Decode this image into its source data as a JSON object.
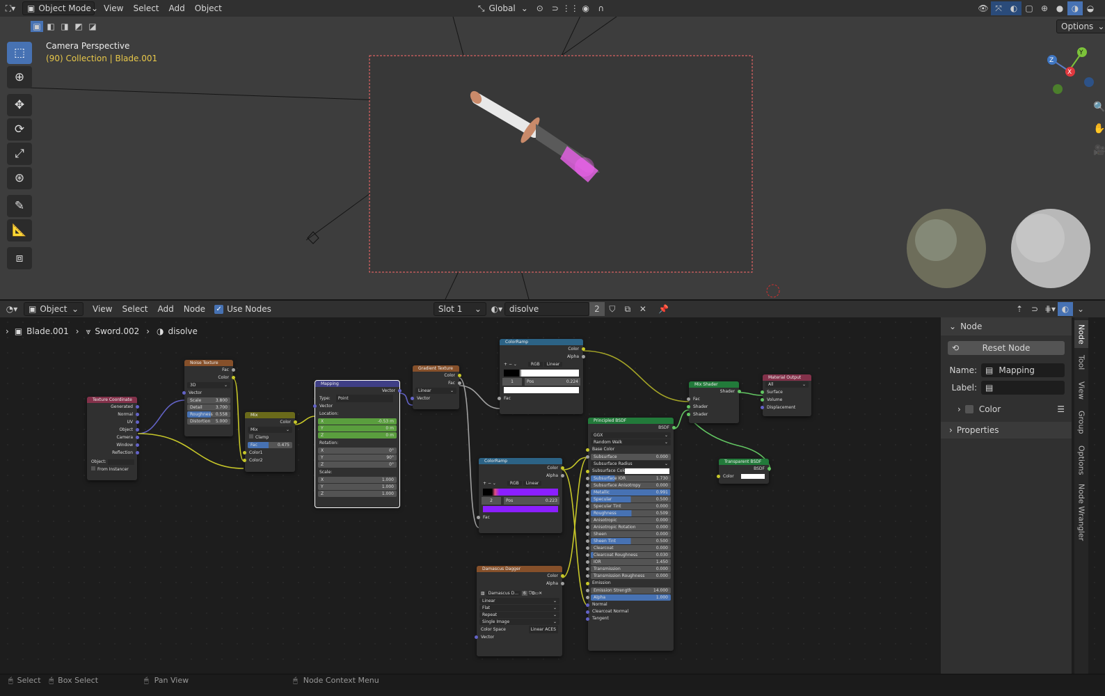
{
  "viewport": {
    "mode": "Object Mode",
    "menus": [
      "View",
      "Select",
      "Add",
      "Object"
    ],
    "transform_orientation": "Global",
    "options_label": "Options",
    "overlay_title": "Camera Perspective",
    "overlay_subtitle": "(90) Collection | Blade.001",
    "axis_labels": {
      "x": "X",
      "y": "Y",
      "z": "Z"
    }
  },
  "node_editor": {
    "object_dropdown": "Object",
    "menus": [
      "View",
      "Select",
      "Add",
      "Node"
    ],
    "use_nodes_label": "Use Nodes",
    "slot": "Slot 1",
    "material_name": "disolve",
    "user_count": "2",
    "breadcrumb": [
      "Blade.001",
      "Sword.002",
      "disolve"
    ]
  },
  "nodes": {
    "texcoord": {
      "title": "Texture Coordinate",
      "outputs": [
        "Generated",
        "Normal",
        "UV",
        "Object",
        "Camera",
        "Window",
        "Reflection"
      ],
      "object_label": "Object:",
      "from_instancer": "From Instancer"
    },
    "noise": {
      "title": "Noise Texture",
      "outputs": [
        "Fac",
        "Color"
      ],
      "dim": "3D",
      "vector": "Vector",
      "fields": [
        {
          "k": "Scale",
          "v": "3.800"
        },
        {
          "k": "Detail",
          "v": "3.700"
        },
        {
          "k": "Roughness",
          "v": "0.558"
        },
        {
          "k": "Distortion",
          "v": "5.000"
        }
      ]
    },
    "mix": {
      "title": "Mix",
      "output": "Color",
      "blend": "Mix",
      "clamp": "Clamp",
      "fac_k": "Fac",
      "fac_v": "0.475",
      "inputs": [
        "Color1",
        "Color2"
      ]
    },
    "mapping": {
      "title": "Mapping",
      "output": "Vector",
      "type_k": "Type:",
      "type_v": "Point",
      "vector": "Vector",
      "location": "Location:",
      "loc": [
        {
          "k": "X",
          "v": "-0.53 m"
        },
        {
          "k": "Y",
          "v": "0 m"
        },
        {
          "k": "Z",
          "v": "0 m"
        }
      ],
      "rotation": "Rotation:",
      "rot": [
        {
          "k": "X",
          "v": "0°"
        },
        {
          "k": "Y",
          "v": "90°"
        },
        {
          "k": "Z",
          "v": "0°"
        }
      ],
      "scale": "Scale:",
      "scl": [
        {
          "k": "X",
          "v": "1.000"
        },
        {
          "k": "Y",
          "v": "1.000"
        },
        {
          "k": "Z",
          "v": "1.000"
        }
      ]
    },
    "gradient": {
      "title": "Gradient Texture",
      "outputs": [
        "Color",
        "Fac"
      ],
      "interp": "Linear",
      "vector": "Vector"
    },
    "ramp1": {
      "title": "ColorRamp",
      "outputs": [
        "Color",
        "Alpha"
      ],
      "mode": "RGB",
      "interp": "Linear",
      "index": "1",
      "pos_k": "Pos",
      "pos_v": "0.224",
      "input": "Fac"
    },
    "ramp2": {
      "title": "ColorRamp",
      "outputs": [
        "Color",
        "Alpha"
      ],
      "mode": "RGB",
      "interp": "Linear",
      "index": "2",
      "pos_k": "Pos",
      "pos_v": "0.223",
      "input": "Fac",
      "swatch": "#8b1fff"
    },
    "dagger": {
      "title": "Damascus Dagger",
      "outputs": [
        "Color",
        "Alpha"
      ],
      "image": "Damascus D...",
      "users": "6",
      "opts": [
        "Linear",
        "Flat",
        "Repeat",
        "Single Image"
      ],
      "cs_k": "Color Space",
      "cs_v": "Linear ACES",
      "vector": "Vector"
    },
    "bsdf": {
      "title": "Principled BSDF",
      "output": "BSDF",
      "dist": "GGX",
      "sss": "Random Walk",
      "fields": [
        {
          "k": "Base Color",
          "t": "socket"
        },
        {
          "k": "Subsurface",
          "v": "0.000",
          "p": 0
        },
        {
          "k": "Subsurface Radius",
          "t": "drop"
        },
        {
          "k": "Subsurface Color",
          "t": "color"
        },
        {
          "k": "Subsurface IOR",
          "v": "1.730",
          "p": 30
        },
        {
          "k": "Subsurface Anisotropy",
          "v": "0.000",
          "p": 0
        },
        {
          "k": "Metallic",
          "v": "0.991",
          "p": 99
        },
        {
          "k": "Specular",
          "v": "0.500",
          "p": 50
        },
        {
          "k": "Specular Tint",
          "v": "0.000",
          "p": 0
        },
        {
          "k": "Roughness",
          "v": "0.509",
          "p": 51
        },
        {
          "k": "Anisotropic",
          "v": "0.000",
          "p": 0
        },
        {
          "k": "Anisotropic Rotation",
          "v": "0.000",
          "p": 0
        },
        {
          "k": "Sheen",
          "v": "0.000",
          "p": 0
        },
        {
          "k": "Sheen Tint",
          "v": "0.500",
          "p": 50
        },
        {
          "k": "Clearcoat",
          "v": "0.000",
          "p": 0
        },
        {
          "k": "Clearcoat Roughness",
          "v": "0.030",
          "p": 3
        },
        {
          "k": "IOR",
          "v": "1.450",
          "p": 0
        },
        {
          "k": "Transmission",
          "v": "0.000",
          "p": 0
        },
        {
          "k": "Transmission Roughness",
          "v": "0.000",
          "p": 0
        },
        {
          "k": "Emission",
          "t": "socket"
        },
        {
          "k": "Emission Strength",
          "v": "14.000",
          "p": 0
        },
        {
          "k": "Alpha",
          "v": "1.000",
          "p": 100
        },
        {
          "k": "Normal",
          "t": "socket"
        },
        {
          "k": "Clearcoat Normal",
          "t": "socket"
        },
        {
          "k": "Tangent",
          "t": "socket"
        }
      ]
    },
    "mixshader": {
      "title": "Mix Shader",
      "output": "Shader",
      "inputs": [
        "Fac",
        "Shader",
        "Shader"
      ]
    },
    "transparent": {
      "title": "Transparent BSDF",
      "output": "BSDF",
      "input": "Color"
    },
    "output": {
      "title": "Material Output",
      "target": "All",
      "inputs": [
        "Surface",
        "Volume",
        "Displacement"
      ]
    }
  },
  "sidebar": {
    "panel_node": "Node",
    "reset_node": "Reset Node",
    "name_label": "Name:",
    "name_value": "Mapping",
    "label_label": "Label:",
    "color_label": "Color",
    "properties_label": "Properties",
    "tabs": [
      "Node",
      "Tool",
      "View",
      "Group",
      "Options",
      "Node Wrangler"
    ]
  },
  "statusbar": {
    "select": "Select",
    "box_select": "Box Select",
    "pan_view": "Pan View",
    "context_menu": "Node Context Menu"
  }
}
